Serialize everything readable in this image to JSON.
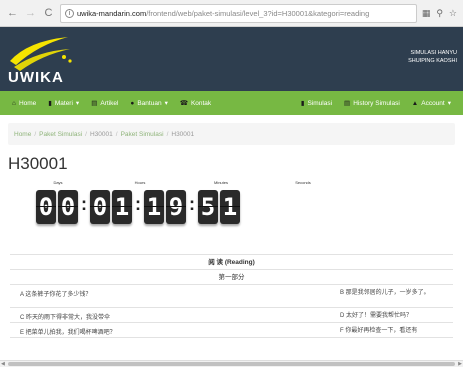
{
  "browser": {
    "url_host": "uwika-mandarin.com",
    "url_path": "/frontend/web/paket-simulasi/level_3?id=H30001&kategori=reading",
    "icons": [
      "back-icon",
      "forward-icon",
      "reload-icon",
      "translate-icon",
      "zoom-icon",
      "star-icon"
    ]
  },
  "header": {
    "logo": "UWIKA",
    "user_line1": "SIMULASI HANYU",
    "user_line2": "SHUIPING KAOSHI"
  },
  "nav": {
    "items": [
      {
        "label": "Home",
        "icon": "home-icon",
        "glyph": "⌂"
      },
      {
        "label": "Materi",
        "icon": "book-icon",
        "glyph": "▮",
        "caret": true
      },
      {
        "label": "Artikel",
        "icon": "list-icon",
        "glyph": "▤"
      },
      {
        "label": "Bantuan",
        "icon": "question-icon",
        "glyph": "●",
        "caret": true
      },
      {
        "label": "Kontak",
        "icon": "phone-icon",
        "glyph": "☎"
      },
      {
        "label": "Simulasi",
        "icon": "file-icon",
        "glyph": "▮"
      },
      {
        "label": "History Simulasi",
        "icon": "list-icon",
        "glyph": "▤"
      },
      {
        "label": "Account",
        "icon": "user-icon",
        "glyph": "▲",
        "caret": true
      }
    ]
  },
  "breadcrumb": {
    "items": [
      "Home",
      "Paket Simulasi",
      "H30001",
      "Paket Simulasi",
      "H30001"
    ]
  },
  "page": {
    "title": "H30001"
  },
  "countdown": {
    "labels": [
      "Days",
      "Hours",
      "Minutes",
      "Seconds"
    ],
    "digits": [
      "0",
      "0",
      "0",
      "1",
      "1",
      "9",
      "5",
      "1"
    ]
  },
  "questions": {
    "section": "阅 读 (Reading)",
    "part": "第一部分",
    "rows": [
      {
        "left": "A 这条裤子你花了多少钱？",
        "right": "B 那是我邻居的儿子，一岁多了。"
      },
      {
        "left": "C 昨天的雨下得非常大，我没带伞",
        "right": "D 太好了！需要我帮忙吗？"
      },
      {
        "left": "E 把菜单儿拍我，我们喝杯啤酒吧？",
        "right": "F 你最好再检查一下，看还有"
      }
    ]
  },
  "colors": {
    "header_bg": "#2e3e4f",
    "nav_bg": "#77b843",
    "logo_yellow": "#f5e400"
  }
}
